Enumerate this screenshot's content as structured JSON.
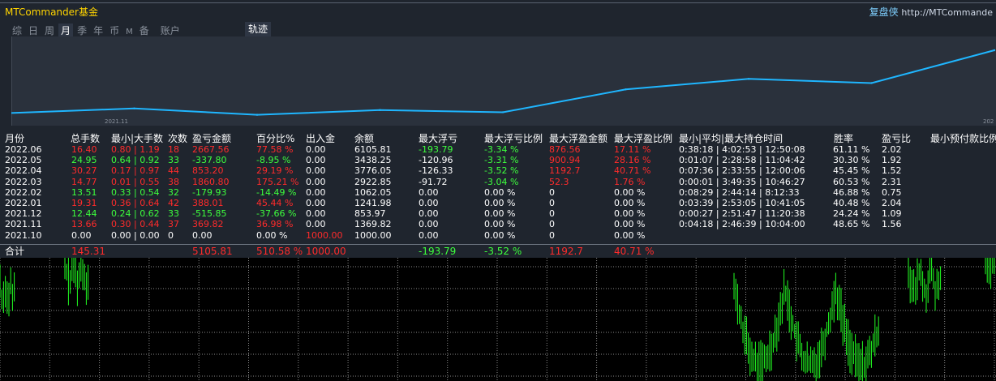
{
  "header": {
    "title": "MTCommander基金",
    "site_prefix": "复盘侠",
    "site_url": "http://MTCommande"
  },
  "tabs": [
    {
      "label": "综",
      "active": false
    },
    {
      "label": "日",
      "active": false
    },
    {
      "label": "周",
      "active": false
    },
    {
      "label": "月",
      "active": true
    },
    {
      "label": "季",
      "active": false
    },
    {
      "label": "年",
      "active": false
    },
    {
      "label": "币",
      "active": false
    },
    {
      "label": "M",
      "active": false
    },
    {
      "label": "备",
      "active": false
    },
    {
      "label": "账户",
      "active": false
    }
  ],
  "trail_button": "轨迹",
  "equity_chart": {
    "x_labels": [
      "2021.11",
      "202"
    ],
    "line_color": "#1fb6ff",
    "values": [
      1000.0,
      1369.82,
      853.97,
      1241.98,
      1062.05,
      2922.85,
      3776.05,
      3438.25,
      6105.81
    ],
    "y_min": 500,
    "y_max": 6700
  },
  "table": {
    "columns": [
      "月份",
      "总手数",
      "最小|大手数",
      "次数",
      "盈亏金额",
      "百分比%",
      "出入金",
      "余额",
      "最大浮亏",
      "最大浮亏比例",
      "最大浮盈金额",
      "最大浮盈比例",
      "最小|平均|最大持仓时间",
      "胜率",
      "盈亏比",
      "最小预付款比例"
    ],
    "rows": [
      {
        "month": "2022.06",
        "lots": "16.40",
        "minmax": "0.80 | 1.19",
        "count": "18",
        "pnl": "2667.56",
        "pct": "77.58 %",
        "io": "0.00",
        "balance": "6105.81",
        "maxdd": "-193.79",
        "maxdd_pct": "-3.34 %",
        "maxfp": "876.56",
        "maxfp_pct": "17.11 %",
        "hold": "0:38:18 | 4:02:53 | 12:50:08",
        "winrate": "61.11 %",
        "pl_ratio": "2.02",
        "colors": {
          "lots": "r",
          "minmax": "r",
          "count": "r",
          "pnl": "r",
          "pct": "r",
          "maxdd": "g",
          "maxdd_pct": "g",
          "maxfp": "r",
          "maxfp_pct": "r"
        }
      },
      {
        "month": "2022.05",
        "lots": "24.95",
        "minmax": "0.64 | 0.92",
        "count": "33",
        "pnl": "-337.80",
        "pct": "-8.95 %",
        "io": "0.00",
        "balance": "3438.25",
        "maxdd": "-120.96",
        "maxdd_pct": "-3.31 %",
        "maxfp": "900.94",
        "maxfp_pct": "28.16 %",
        "hold": "0:01:07 | 2:28:58 | 11:04:42",
        "winrate": "30.30 %",
        "pl_ratio": "1.92",
        "colors": {
          "lots": "g",
          "minmax": "g",
          "count": "g",
          "pnl": "g",
          "pct": "g",
          "maxdd": "w",
          "maxdd_pct": "g",
          "maxfp": "r",
          "maxfp_pct": "r"
        }
      },
      {
        "month": "2022.04",
        "lots": "30.27",
        "minmax": "0.17 | 0.97",
        "count": "44",
        "pnl": "853.20",
        "pct": "29.19 %",
        "io": "0.00",
        "balance": "3776.05",
        "maxdd": "-126.33",
        "maxdd_pct": "-3.52 %",
        "maxfp": "1192.7",
        "maxfp_pct": "40.71 %",
        "hold": "0:07:36 | 2:33:55 | 12:00:06",
        "winrate": "45.45 %",
        "pl_ratio": "1.52",
        "colors": {
          "lots": "r",
          "minmax": "r",
          "count": "r",
          "pnl": "r",
          "pct": "r",
          "maxdd": "w",
          "maxdd_pct": "g",
          "maxfp": "r",
          "maxfp_pct": "r"
        }
      },
      {
        "month": "2022.03",
        "lots": "14.77",
        "minmax": "0.01 | 0.55",
        "count": "38",
        "pnl": "1860.80",
        "pct": "175.21 %",
        "io": "0.00",
        "balance": "2922.85",
        "maxdd": "-91.72",
        "maxdd_pct": "-3.04 %",
        "maxfp": "52.3",
        "maxfp_pct": "1.76 %",
        "hold": "0:00:01 | 3:49:35 | 10:46:27",
        "winrate": "60.53 %",
        "pl_ratio": "2.31",
        "colors": {
          "lots": "r",
          "minmax": "r",
          "count": "r",
          "pnl": "r",
          "pct": "r",
          "maxdd": "w",
          "maxdd_pct": "g",
          "maxfp": "r",
          "maxfp_pct": "r"
        }
      },
      {
        "month": "2022.02",
        "lots": "13.51",
        "minmax": "0.33 | 0.54",
        "count": "32",
        "pnl": "-179.93",
        "pct": "-14.49 %",
        "io": "0.00",
        "balance": "1062.05",
        "maxdd": "0.00",
        "maxdd_pct": "0.00 %",
        "maxfp": "0",
        "maxfp_pct": "0.00 %",
        "hold": "0:08:29 | 2:44:14 | 8:12:33",
        "winrate": "46.88 %",
        "pl_ratio": "0.75",
        "colors": {
          "lots": "g",
          "minmax": "g",
          "count": "g",
          "pnl": "g",
          "pct": "g",
          "maxdd": "w",
          "maxdd_pct": "w",
          "maxfp": "w",
          "maxfp_pct": "w"
        }
      },
      {
        "month": "2022.01",
        "lots": "19.31",
        "minmax": "0.36 | 0.64",
        "count": "42",
        "pnl": "388.01",
        "pct": "45.44 %",
        "io": "0.00",
        "balance": "1241.98",
        "maxdd": "0.00",
        "maxdd_pct": "0.00 %",
        "maxfp": "0",
        "maxfp_pct": "0.00 %",
        "hold": "0:03:39 | 2:53:05 | 10:41:05",
        "winrate": "40.48 %",
        "pl_ratio": "2.04",
        "colors": {
          "lots": "r",
          "minmax": "r",
          "count": "r",
          "pnl": "r",
          "pct": "r",
          "maxdd": "w",
          "maxdd_pct": "w",
          "maxfp": "w",
          "maxfp_pct": "w"
        }
      },
      {
        "month": "2021.12",
        "lots": "12.44",
        "minmax": "0.24 | 0.62",
        "count": "33",
        "pnl": "-515.85",
        "pct": "-37.66 %",
        "io": "0.00",
        "balance": "853.97",
        "maxdd": "0.00",
        "maxdd_pct": "0.00 %",
        "maxfp": "0",
        "maxfp_pct": "0.00 %",
        "hold": "0:00:27 | 2:51:47 | 11:20:38",
        "winrate": "24.24 %",
        "pl_ratio": "1.09",
        "colors": {
          "lots": "g",
          "minmax": "g",
          "count": "g",
          "pnl": "g",
          "pct": "g",
          "maxdd": "w",
          "maxdd_pct": "w",
          "maxfp": "w",
          "maxfp_pct": "w"
        }
      },
      {
        "month": "2021.11",
        "lots": "13.66",
        "minmax": "0.30 | 0.44",
        "count": "37",
        "pnl": "369.82",
        "pct": "36.98 %",
        "io": "0.00",
        "balance": "1369.82",
        "maxdd": "0.00",
        "maxdd_pct": "0.00 %",
        "maxfp": "0",
        "maxfp_pct": "0.00 %",
        "hold": "0:04:18 | 2:46:39 | 10:04:00",
        "winrate": "48.65 %",
        "pl_ratio": "1.56",
        "colors": {
          "lots": "r",
          "minmax": "r",
          "count": "r",
          "pnl": "r",
          "pct": "r",
          "maxdd": "w",
          "maxdd_pct": "w",
          "maxfp": "w",
          "maxfp_pct": "w"
        }
      },
      {
        "month": "2021.10",
        "lots": "0.00",
        "minmax": "0.00 | 0.00",
        "count": "0",
        "pnl": "0.00",
        "pct": "0.00 %",
        "io": "1000.00",
        "balance": "1000.00",
        "maxdd": "0.00",
        "maxdd_pct": "0.00 %",
        "maxfp": "0",
        "maxfp_pct": "0.00 %",
        "hold": "",
        "winrate": "",
        "pl_ratio": "",
        "colors": {
          "lots": "w",
          "minmax": "w",
          "count": "w",
          "pnl": "w",
          "pct": "w",
          "io": "r",
          "maxdd": "w",
          "maxdd_pct": "w",
          "maxfp": "w",
          "maxfp_pct": "w"
        }
      }
    ],
    "total": {
      "month": "合计",
      "lots": "145.31",
      "pnl": "5105.81",
      "pct": "510.58 %",
      "io": "1000.00",
      "maxdd": "-193.79",
      "maxdd_pct": "-3.52 %",
      "maxfp": "1192.7",
      "maxfp_pct": "40.71 %"
    }
  },
  "bottom_chart": {
    "background": "#000000",
    "grid_color": "#ffffff",
    "bar_color": "#22ff22"
  }
}
